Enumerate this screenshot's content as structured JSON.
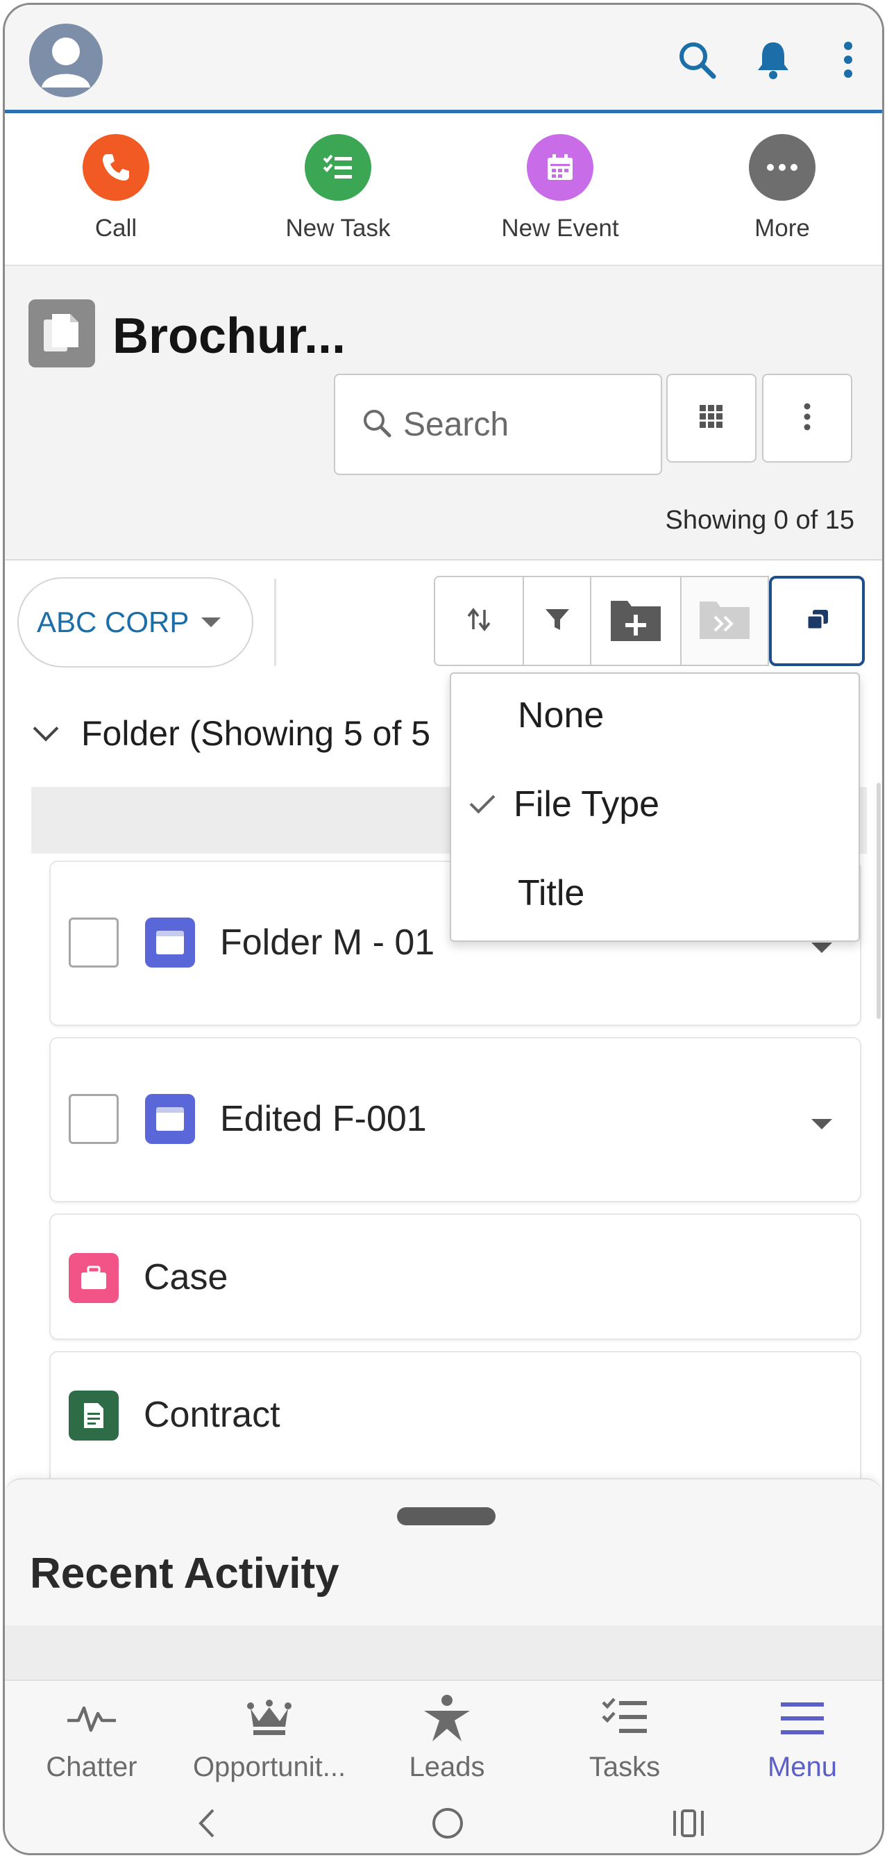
{
  "quick_actions": [
    {
      "label": "Call",
      "color": "#f15a22",
      "icon": "phone-icon"
    },
    {
      "label": "New Task",
      "color": "#3ba755",
      "icon": "task-icon"
    },
    {
      "label": "New Event",
      "color": "#c86ce8",
      "icon": "calendar-icon"
    },
    {
      "label": "More",
      "color": "#6e6e6e",
      "icon": "more-dots-icon"
    }
  ],
  "list_header": {
    "title": "Brochur...",
    "search_placeholder": "Search",
    "showing": "Showing 0 of 15"
  },
  "toolbar": {
    "scope": "ABC CORP"
  },
  "section": {
    "title": "Folder (Showing 5 of 5"
  },
  "rows": [
    {
      "label": "Folder M - 01",
      "icon": "folder-icon",
      "color": "#5a67d8"
    },
    {
      "label": "Edited F-001",
      "icon": "folder-icon",
      "color": "#5a67d8"
    },
    {
      "label": "Case",
      "icon": "case-icon",
      "color": "#f25487"
    },
    {
      "label": "Contract",
      "icon": "contract-icon",
      "color": "#2e6b47"
    }
  ],
  "group_by_menu": {
    "items": [
      "None",
      "File Type",
      "Title"
    ],
    "selected": "File Type"
  },
  "recent_activity": {
    "title": "Recent Activity"
  },
  "bottom_nav": [
    {
      "label": "Chatter",
      "icon": "pulse-icon"
    },
    {
      "label": "Opportunit...",
      "icon": "crown-icon"
    },
    {
      "label": "Leads",
      "icon": "star-person-icon"
    },
    {
      "label": "Tasks",
      "icon": "checklist-icon"
    },
    {
      "label": "Menu",
      "icon": "hamburger-icon"
    }
  ],
  "colors": {
    "brand_blue": "#1b6ea8",
    "header_rule": "#2a6fb0",
    "menu_accent": "#5b5fc7"
  }
}
